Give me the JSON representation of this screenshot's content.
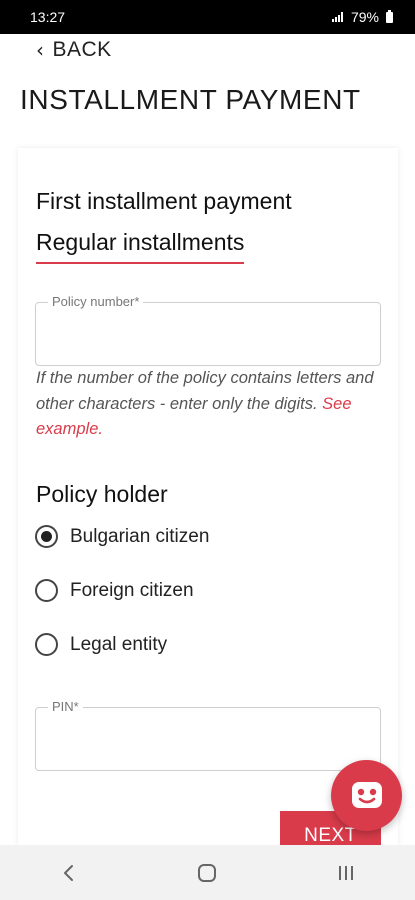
{
  "status_bar": {
    "time": "13:27",
    "battery": "79%"
  },
  "header": {
    "back_label": "BACK",
    "title": "INSTALLMENT PAYMENT"
  },
  "installment_options": {
    "first": "First installment payment",
    "regular": "Regular installments",
    "selected": "regular"
  },
  "policy_field": {
    "label": "Policy number*",
    "value": "",
    "hint_text": "If the number of the policy contains letters and other characters - enter only the digits.",
    "hint_link": "See example."
  },
  "policy_holder": {
    "title": "Policy holder",
    "options": [
      {
        "label": "Bulgarian citizen",
        "checked": true
      },
      {
        "label": "Foreign citizen",
        "checked": false
      },
      {
        "label": "Legal entity",
        "checked": false
      }
    ]
  },
  "pin_field": {
    "label": "PIN*",
    "value": ""
  },
  "actions": {
    "next_label": "NEXT"
  },
  "colors": {
    "accent": "#d93b4a",
    "status_bar": "#000000",
    "nav_bar": "#f2f2f2"
  },
  "icons": {
    "back": "chevron-left-icon",
    "chat": "chatbot-icon",
    "nav_back": "nav-back-icon",
    "nav_home": "nav-home-icon",
    "nav_recents": "nav-recents-icon"
  }
}
